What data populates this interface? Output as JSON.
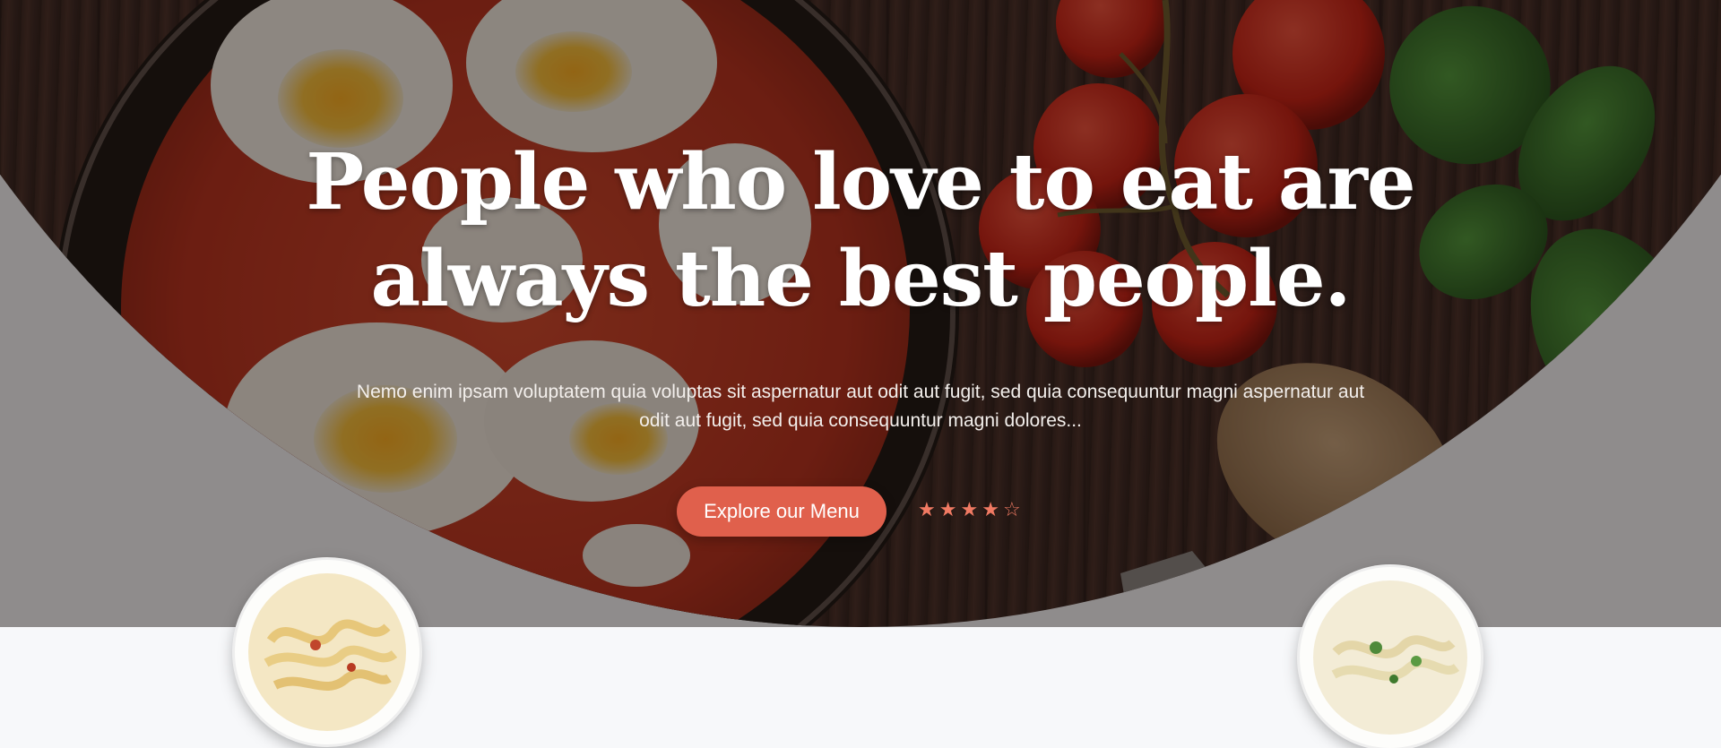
{
  "hero": {
    "headline": "People who love to eat are always the best people.",
    "subtext": "Nemo enim ipsam voluptatem quia voluptas sit aspernatur aut odit aut fugit, sed quia consequuntur magni aspernatur aut odit aut fugit, sed quia consequuntur magni dolores...",
    "cta_label": "Explore our Menu",
    "rating": {
      "value": 4,
      "max": 5
    }
  },
  "colors": {
    "accent": "#e0604c",
    "star": "#f07a63",
    "page_background": "#f7f8fa",
    "wood": "#3a2620"
  },
  "icons": [
    "star-filled-icon",
    "star-outline-icon"
  ]
}
